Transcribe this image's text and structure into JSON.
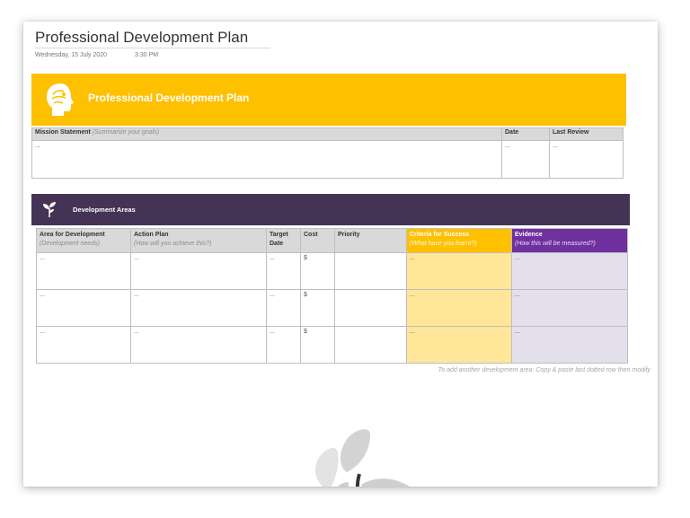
{
  "document": {
    "title": "Professional Development Plan",
    "date": "Wednesday, 15 July 2020",
    "time": "3:30 PM"
  },
  "banner": {
    "title": "Professional Development Plan",
    "icon": "head-silhouette-icon",
    "color": "#ffc000"
  },
  "mission": {
    "headers": {
      "statement": "Mission Statement",
      "statement_hint": "(Summarize your goals)",
      "date": "Date",
      "last_review": "Last Review"
    },
    "row": {
      "statement": "...",
      "date": "...",
      "last_review": "..."
    }
  },
  "development": {
    "title": "Development Areas",
    "icon": "sprout-icon",
    "color": "#443355",
    "headers": {
      "area": "Area for Development",
      "area_hint": "(Development needs)",
      "action": "Action Plan",
      "action_hint": "(How will you achieve this?)",
      "target_line1": "Target",
      "target_line2": "Date",
      "cost": "Cost",
      "priority": "Priority",
      "success": "Criteria for Success",
      "success_hint": "(What have you learnt?)",
      "evidence": "Evidence",
      "evidence_hint": "(How this will be measured?)"
    },
    "rows": [
      {
        "area": "...",
        "action": "...",
        "target": "...",
        "cost": "$",
        "priority": "",
        "success": "...",
        "evidence": "..."
      },
      {
        "area": "...",
        "action": "...",
        "target": "...",
        "cost": "$",
        "priority": "",
        "success": "...",
        "evidence": "..."
      },
      {
        "area": "...",
        "action": "...",
        "target": "...",
        "cost": "$",
        "priority": "",
        "success": "...",
        "evidence": "..."
      }
    ],
    "hint": "To add another development area: Copy & paste last dotted row then modify"
  },
  "colors": {
    "success_header": "#ffc000",
    "success_cell": "#ffe699",
    "evidence_header": "#7030a0",
    "evidence_cell": "#e4dfec"
  }
}
